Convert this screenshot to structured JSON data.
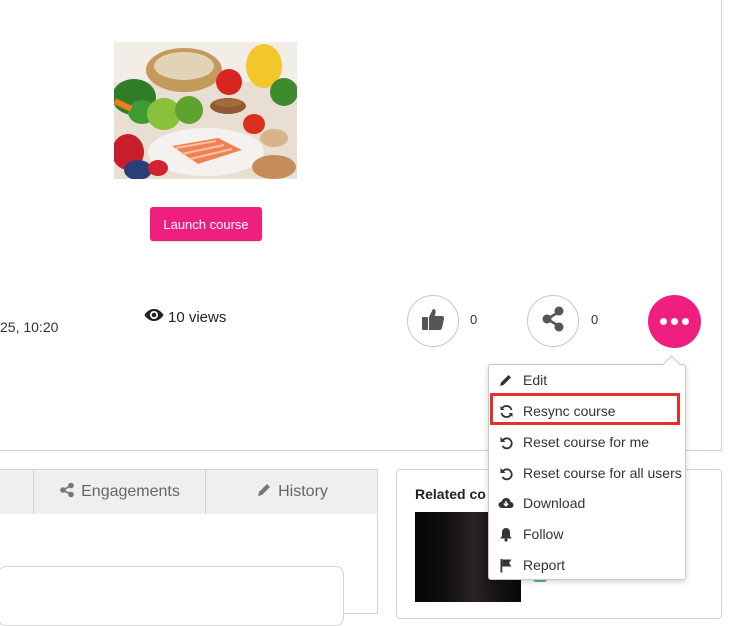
{
  "course": {
    "launch_label": "Launch course",
    "date_fragment": "25, 10:20",
    "views_label": "10 views",
    "likes_count": "0",
    "shares_count": "0"
  },
  "tabs": [
    {
      "label": "Engagements",
      "icon": "share-icon"
    },
    {
      "label": "History",
      "icon": "pencil-icon"
    }
  ],
  "related": {
    "title": "Related co"
  },
  "menu": {
    "items": [
      {
        "label": "Edit",
        "icon": "pencil-icon"
      },
      {
        "label": "Resync course",
        "icon": "sync-icon"
      },
      {
        "label": "Reset course for me",
        "icon": "undo-icon"
      },
      {
        "label": "Reset course for all users",
        "icon": "undo-icon"
      },
      {
        "label": "Download",
        "icon": "cloud-download-icon"
      },
      {
        "label": "Follow",
        "icon": "bell-icon"
      },
      {
        "label": "Report",
        "icon": "flag-icon"
      }
    ],
    "highlighted_item": "Resync course"
  },
  "colors": {
    "accent": "#ee1f7e",
    "highlight_border": "#e5302a"
  }
}
